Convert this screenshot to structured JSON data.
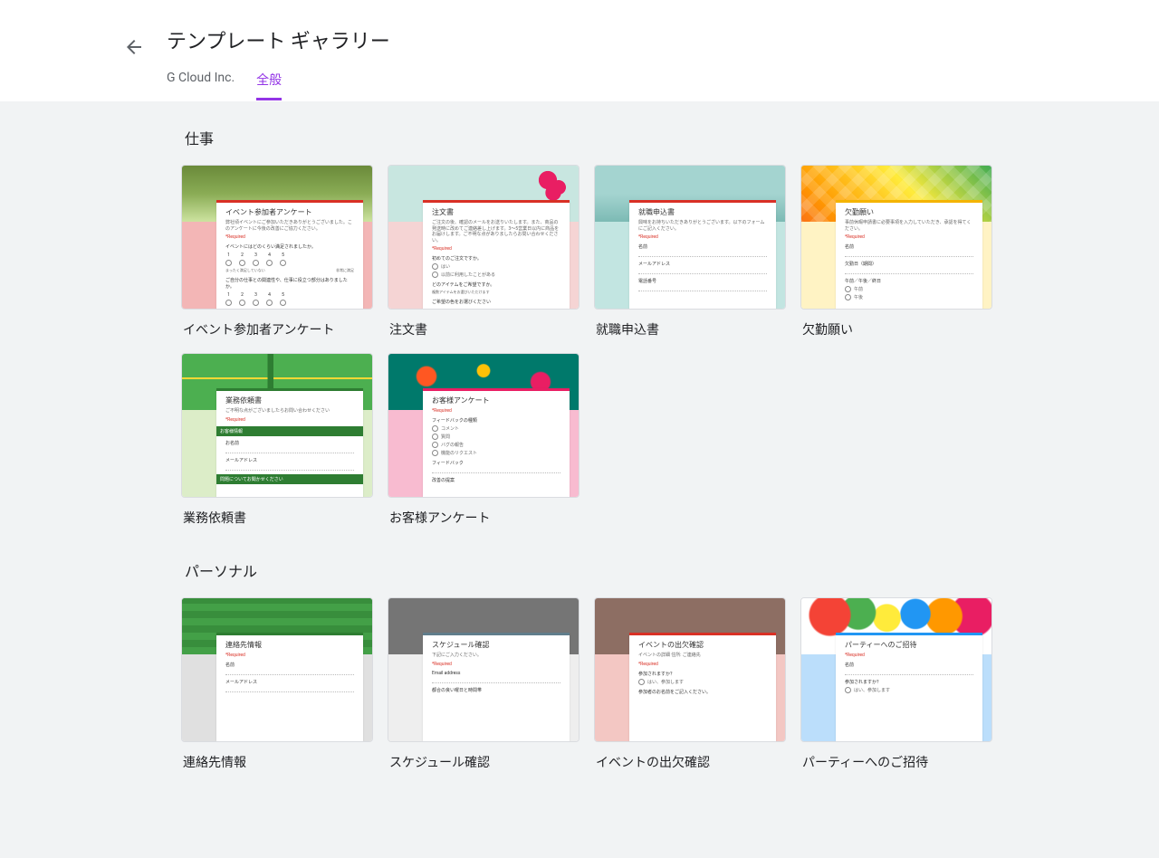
{
  "header": {
    "title": "テンプレート ギャラリー",
    "tabs": [
      {
        "label": "G Cloud Inc.",
        "active": false
      },
      {
        "label": "全般",
        "active": true
      }
    ]
  },
  "sections": [
    {
      "title": "仕事",
      "templates": [
        {
          "title": "イベント参加者アンケート",
          "form_title": "イベント参加者アンケート",
          "accent": "#d93025",
          "top_class": "bg-event",
          "fill_class": "bg-event-fill",
          "desc": "弊社頃イベントにご参加いただきありがとうございました。このアンケートに今後の改善にご協力ください。",
          "q1": "イベントにはどのくらい満足されましたか。",
          "scale_low": "まったく満足していない",
          "scale_high": "非常に満足",
          "q2": "ご自分の仕事との関連性や、仕事に役立つ部分はありましたか。"
        },
        {
          "title": "注文書",
          "form_title": "注文書",
          "accent": "#d93025",
          "top_class": "bg-order",
          "fill_class": "bg-order-fill",
          "desc": "ご注文の後、確認のメールをお送りいたします。また、商品の発送時に改めてご連絡差し上げます。3～5営業日以内に商品をお届けします。ご不明な点がありましたらお問い合わせください。",
          "q1": "初めてのご注文ですか。",
          "opts1": [
            "はい",
            "以前に利用したことがある"
          ],
          "q2": "どのアイテムをご希望ですか。",
          "q3": "ご希望の色をお選びください"
        },
        {
          "title": "就職申込書",
          "form_title": "就職申込書",
          "accent": "#d93025",
          "top_class": "bg-job",
          "fill_class": "bg-job-fill",
          "desc": "興味をお持ちいただきありがとうございます。以下のフォームにご記入ください。",
          "fields": [
            "名前",
            "メールアドレス",
            "電話番号"
          ]
        },
        {
          "title": "欠勤願い",
          "form_title": "欠勤願い",
          "accent": "#f4b400",
          "top_class": "bg-absent",
          "fill_class": "bg-absent-fill",
          "desc": "事前休暇申請書に必要事項を入力していただき、承認を得てください。",
          "fields": [
            "名前",
            "欠勤日（期間）",
            "午前／午後／終日"
          ],
          "opts": [
            "午前",
            "午後"
          ]
        },
        {
          "title": "業務依頼書",
          "form_title": "業務依頼書",
          "accent": "#2e7d32",
          "top_class": "bg-work",
          "fill_class": "bg-work-fill",
          "desc": "ご不明な点がございましたらお問い合わせください",
          "bar1": "お客様情報",
          "fields": [
            "お名前",
            "メールアドレス"
          ],
          "bar2": "問題についてお聞かせください"
        },
        {
          "title": "お客様アンケート",
          "form_title": "お客様アンケート",
          "accent": "#e91e63",
          "top_class": "bg-cust",
          "fill_class": "bg-cust-fill",
          "q1": "フィードバックの種類",
          "opts": [
            "コメント",
            "質問",
            "バグの報告",
            "機能のリクエスト"
          ],
          "q2": "フィードバック",
          "q3": "改善の提案"
        }
      ]
    },
    {
      "title": "パーソナル",
      "templates": [
        {
          "title": "連絡先情報",
          "form_title": "連絡先情報",
          "accent": "#2e7d32",
          "top_class": "bg-contact",
          "fill_class": "bg-contact-fill",
          "fields": [
            "名前",
            "メールアドレス"
          ]
        },
        {
          "title": "スケジュール確認",
          "form_title": "スケジュール確認",
          "accent": "#607d8b",
          "top_class": "bg-sched",
          "fill_class": "bg-sched-fill",
          "desc": "下記にご入力ください。",
          "fields": [
            "Email address",
            "都合の良い曜日と時間帯"
          ]
        },
        {
          "title": "イベントの出欠確認",
          "form_title": "イベントの出欠確認",
          "accent": "#d93025",
          "top_class": "bg-rsvp",
          "fill_class": "bg-rsvp-fill",
          "desc": "イベントの詳細 住所: ご連絡先",
          "q1": "参加されますか？",
          "opts": [
            "はい、参加します"
          ],
          "q2": "参加者のお名前をご記入ください。"
        },
        {
          "title": "パーティーへのご招待",
          "form_title": "パーティーへのご招待",
          "accent": "#2196f3",
          "top_class": "bg-party",
          "fill_class": "bg-party-fill",
          "fields": [
            "名前"
          ],
          "q1": "参加されますか？",
          "opts": [
            "はい、参加します"
          ]
        }
      ]
    }
  ]
}
